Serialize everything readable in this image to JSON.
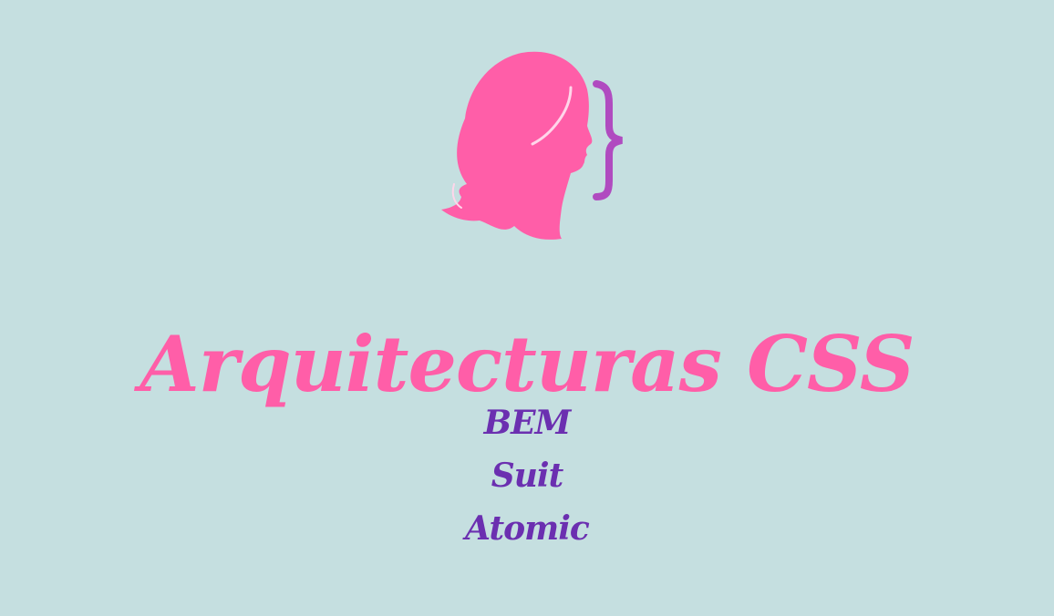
{
  "colors": {
    "background": "#c5dfe0",
    "title": "#ff5ea8",
    "logo_head": "#ff5ea8",
    "logo_brace": "#b04bc0",
    "nav_link": "#6b2fb0"
  },
  "logo": {
    "icon": "woman-profile-with-curly-brace-icon"
  },
  "title": "Arquitecturas CSS",
  "nav": {
    "items": [
      {
        "label": "BEM"
      },
      {
        "label": "Suit"
      },
      {
        "label": "Atomic"
      }
    ]
  }
}
